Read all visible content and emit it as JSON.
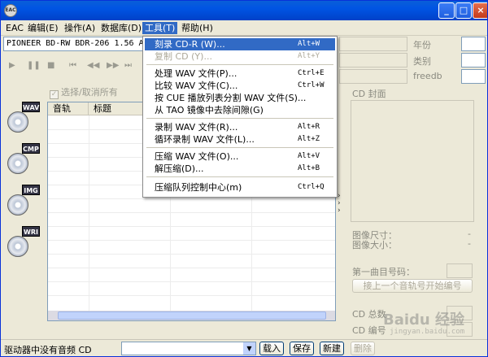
{
  "app": {
    "icon_text": "EAC"
  },
  "title_buttons": {
    "minimize": "_",
    "maximize": "□",
    "close": "×"
  },
  "menubar": [
    {
      "label": "EAC"
    },
    {
      "label": "编辑(E)"
    },
    {
      "label": "操作(A)"
    },
    {
      "label": "数据库(D)"
    },
    {
      "label": "工具(T)"
    },
    {
      "label": "帮助(H)"
    }
  ],
  "drive": {
    "value": "PIONEER BD-RW   BDR-206 1.56  Ad"
  },
  "controls": {
    "play": "▶",
    "pause": "❚❚",
    "stop": "■",
    "first": "⏮",
    "prev": "◀◀",
    "next": "▶▶",
    "last": "⏭"
  },
  "select_all": {
    "label": "选择/取消所有"
  },
  "side_buttons": [
    {
      "tag": "WAV"
    },
    {
      "tag": "CMP"
    },
    {
      "tag": "IMG"
    },
    {
      "tag": "WRI"
    }
  ],
  "track_table": {
    "columns": [
      "音轨",
      "标题"
    ]
  },
  "right_panel": {
    "year_label": "年份",
    "genre_label": "类别",
    "freedb_label": "freedb",
    "cover_label": "CD 封面",
    "img_size_label": "图像尺寸：",
    "img_size_value": "-",
    "img_bytes_label": "图像大小：",
    "img_bytes_value": "-",
    "first_track_label": "第一曲目号码：",
    "continue_button": "接上一个音轨号开始编号",
    "cd_total_label": "CD 总数",
    "cd_number_label": "CD 编号"
  },
  "tools_menu": [
    {
      "label": "刻录 CD-R (W)...",
      "shortcut": "Alt+W",
      "state": "highlighted"
    },
    {
      "label": "复制 CD (Y)...",
      "shortcut": "Alt+Y",
      "state": "disabled"
    },
    {
      "separator": true
    },
    {
      "label": "处理 WAV 文件(P)...",
      "shortcut": "Ctrl+E",
      "state": "normal"
    },
    {
      "label": "比较 WAV 文件(C)...",
      "shortcut": "Ctrl+W",
      "state": "normal"
    },
    {
      "label": "按 CUE 播放列表分割 WAV 文件(S)...",
      "shortcut": "",
      "state": "normal"
    },
    {
      "label": "从 TAO 镜像中去除间隙(G)",
      "shortcut": "",
      "state": "normal"
    },
    {
      "separator": true
    },
    {
      "label": "录制 WAV 文件(R)...",
      "shortcut": "Alt+R",
      "state": "normal"
    },
    {
      "label": "循环录制 WAV 文件(L)...",
      "shortcut": "Alt+Z",
      "state": "normal"
    },
    {
      "separator": true
    },
    {
      "label": "压缩 WAV 文件(O)...",
      "shortcut": "Alt+V",
      "state": "normal"
    },
    {
      "label": "解压缩(D)...",
      "shortcut": "Alt+B",
      "state": "normal"
    },
    {
      "separator": true
    },
    {
      "label": "压缩队列控制中心(m)",
      "shortcut": "Ctrl+Q",
      "state": "normal"
    }
  ],
  "statusbar": {
    "message": "驱动器中没有音频 CD",
    "load_button": "载入",
    "save_button": "保存",
    "new_button": "新建",
    "delete_button": "删除"
  },
  "watermark": {
    "text": "Baidu 经验",
    "sub": "jingyan.baidu.com"
  }
}
